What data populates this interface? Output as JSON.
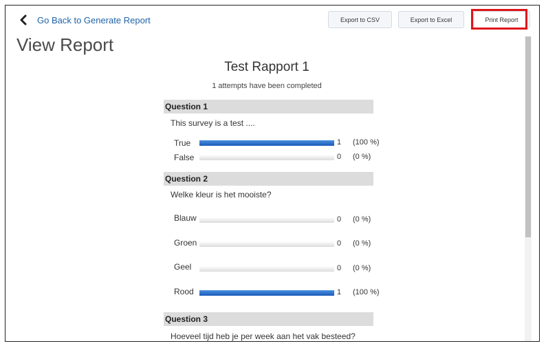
{
  "nav": {
    "back_label": "Go Back to Generate Report"
  },
  "toolbar": {
    "export_csv": "Export to CSV",
    "export_excel": "Export to Excel",
    "print_report": "Print Report"
  },
  "page": {
    "title": "View Report"
  },
  "report": {
    "title": "Test Rapport 1",
    "attempts_text": "1 attempts have been completed",
    "questions": [
      {
        "heading": "Question 1",
        "text": "This survey is a test ....",
        "answers": [
          {
            "label": "True",
            "count": "1",
            "percent": "(100 %)",
            "fraction": 1
          },
          {
            "label": "False",
            "count": "0",
            "percent": "(0 %)",
            "fraction": 0
          }
        ]
      },
      {
        "heading": "Question 2",
        "text": "Welke kleur is het mooiste?",
        "answers": [
          {
            "label": "Blauw",
            "count": "0",
            "percent": "(0 %)",
            "fraction": 0
          },
          {
            "label": "Groen",
            "count": "0",
            "percent": "(0 %)",
            "fraction": 0
          },
          {
            "label": "Geel",
            "count": "0",
            "percent": "(0 %)",
            "fraction": 0
          },
          {
            "label": "Rood",
            "count": "1",
            "percent": "(100 %)",
            "fraction": 1
          }
        ]
      },
      {
        "heading": "Question 3",
        "text": "Hoeveel tijd heb je per week aan het vak besteed?",
        "answers": []
      }
    ]
  },
  "colors": {
    "link": "#1f63a6",
    "bar_fill": "#1a5bb8",
    "highlight": "#e0141b",
    "question_header_bg": "#dcdcdc"
  },
  "icons": {
    "back": "chevron-left-icon"
  }
}
